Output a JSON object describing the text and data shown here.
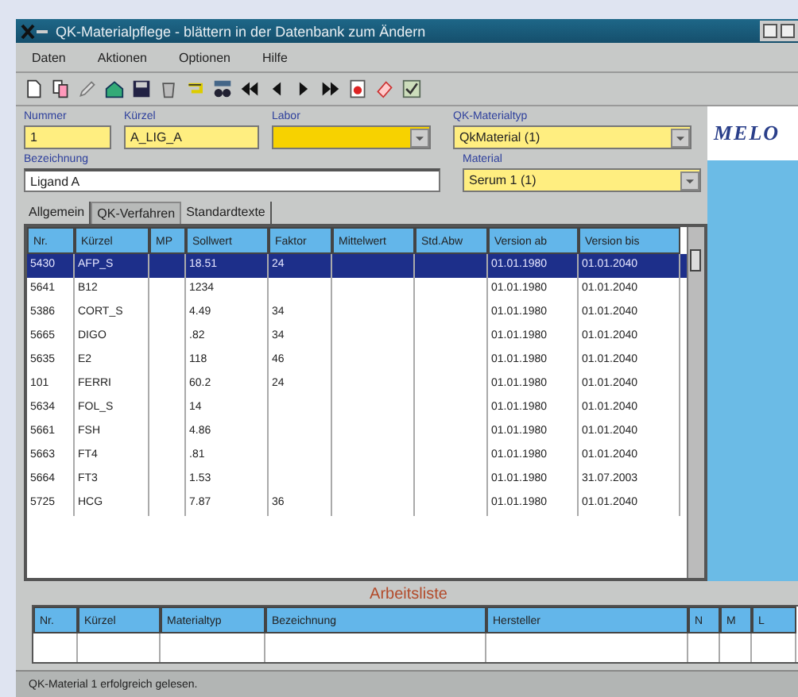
{
  "window": {
    "title": "QK-Materialpflege - blättern in der Datenbank zum Ändern"
  },
  "menu": [
    "Daten",
    "Aktionen",
    "Optionen",
    "Hilfe"
  ],
  "fields": [
    {
      "label": "Nummer",
      "value": "1",
      "kind": "text",
      "focused": false
    },
    {
      "label": "Kürzel",
      "value": "A_LIG_A",
      "kind": "text",
      "focused": false
    },
    {
      "label": "Labor",
      "kind": "dropdown",
      "focused": true
    },
    {
      "label": "QK-Materialtyp",
      "value": "QkMaterial (1)",
      "kind": "dropdown",
      "focused": false
    }
  ],
  "logo": "MELO",
  "description": {
    "label": "Bezeichnung",
    "value": "Ligand A"
  },
  "material": {
    "label": "Material",
    "value": "Serum 1 (1)"
  },
  "tabs": [
    {
      "label": "Allgemein",
      "selected": false
    },
    {
      "label": "QK-Verfahren",
      "selected": true
    },
    {
      "label": "Standardtexte",
      "selected": false
    }
  ],
  "table": {
    "columns": [
      "Nr.",
      "Kürzel",
      "MP",
      "Sollwert",
      "Faktor",
      "Mittelwert",
      "Std.Abw",
      "Version ab",
      "Version bis"
    ],
    "rows": [
      {
        "selected": true,
        "cells": [
          "5430",
          "AFP_S",
          "",
          "18.51",
          "24",
          "",
          "",
          "01.01.1980",
          "01.01.2040"
        ]
      },
      {
        "selected": false,
        "cells": [
          "5641",
          "B12",
          "",
          "1234",
          "",
          "",
          "",
          "01.01.1980",
          "01.01.2040"
        ]
      },
      {
        "selected": false,
        "cells": [
          "5386",
          "CORT_S",
          "",
          "4.49",
          "34",
          "",
          "",
          "01.01.1980",
          "01.01.2040"
        ]
      },
      {
        "selected": false,
        "cells": [
          "5665",
          "DIGO",
          "",
          ".82",
          "34",
          "",
          "",
          "01.01.1980",
          "01.01.2040"
        ]
      },
      {
        "selected": false,
        "cells": [
          "5635",
          "E2",
          "",
          "118",
          "46",
          "",
          "",
          "01.01.1980",
          "01.01.2040"
        ]
      },
      {
        "selected": false,
        "cells": [
          "101",
          "FERRI",
          "",
          "60.2",
          "24",
          "",
          "",
          "01.01.1980",
          "01.01.2040"
        ]
      },
      {
        "selected": false,
        "cells": [
          "5634",
          "FOL_S",
          "",
          "14",
          "",
          "",
          "",
          "01.01.1980",
          "01.01.2040"
        ]
      },
      {
        "selected": false,
        "cells": [
          "5661",
          "FSH",
          "",
          "4.86",
          "",
          "",
          "",
          "01.01.1980",
          "01.01.2040"
        ]
      },
      {
        "selected": false,
        "cells": [
          "5663",
          "FT4",
          "",
          ".81",
          "",
          "",
          "",
          "01.01.1980",
          "01.01.2040"
        ]
      },
      {
        "selected": false,
        "cells": [
          "5664",
          "FT3",
          "",
          "1.53",
          "",
          "",
          "",
          "01.01.1980",
          "31.07.2003"
        ]
      },
      {
        "selected": false,
        "cells": [
          "5725",
          "HCG",
          "",
          "7.87",
          "36",
          "",
          "",
          "01.01.1980",
          "01.01.2040"
        ]
      }
    ]
  },
  "worklist": {
    "title": "Arbeitsliste",
    "columns": [
      "Nr.",
      "Kürzel",
      "Materialtyp",
      "Bezeichnung",
      "Hersteller",
      "N",
      "M",
      "L"
    ]
  },
  "status_bar": "QK-Material 1 erfolgreich gelesen."
}
